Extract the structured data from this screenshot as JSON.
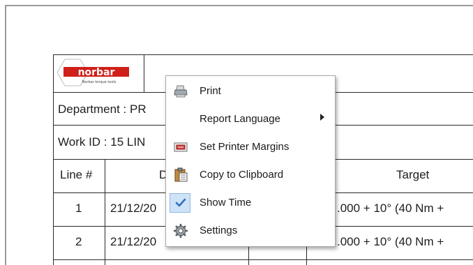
{
  "report": {
    "logo_text": "norbar",
    "logo_tagline": "Norbar torque tools",
    "department_label": "Department : PR",
    "work_id_label": "Work ID : 15 LIN",
    "header_line": "Line #",
    "header_date": "D",
    "header_target": "Target",
    "rows": [
      {
        "line": "1",
        "date": "21/12/20",
        "target": ".000 + 10° (40 Nm +"
      },
      {
        "line": "2",
        "date": "21/12/20",
        "target": ".000 + 10° (40 Nm +"
      }
    ]
  },
  "context_menu": {
    "items": [
      {
        "label": "Print",
        "icon": "printer-icon"
      },
      {
        "label": "Report Language",
        "icon": "",
        "has_submenu": true
      },
      {
        "label": "Set Printer Margins",
        "icon": "margins-icon"
      },
      {
        "label": "Copy to Clipboard",
        "icon": "clipboard-icon"
      },
      {
        "label": "Show Time",
        "icon": "checkmark-icon",
        "checked": true
      },
      {
        "label": "Settings",
        "icon": "gear-icon"
      }
    ]
  },
  "colors": {
    "logo_red": "#d0201a",
    "check_blue": "#2f6fbf",
    "check_bg": "#cfe3f7"
  }
}
